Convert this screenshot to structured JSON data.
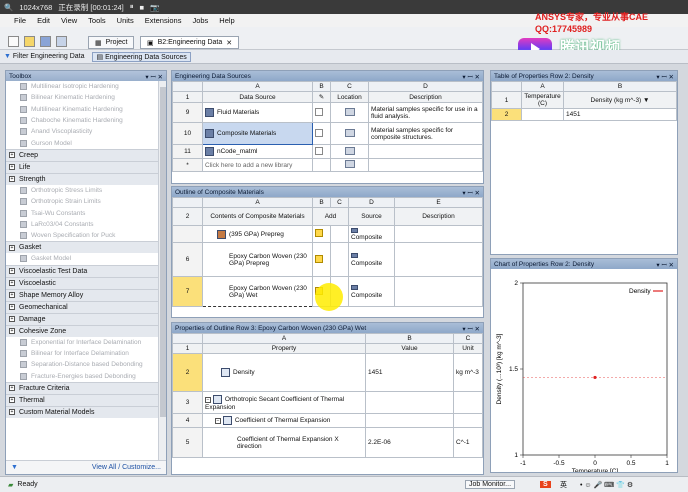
{
  "recorder": {
    "resolution": "1024x768",
    "status": "正在录制 [00:01:24]"
  },
  "menu": [
    "File",
    "Edit",
    "View",
    "Tools",
    "Units",
    "Extensions",
    "Jobs",
    "Help"
  ],
  "tabs": {
    "project": "Project",
    "engineering_data": "B2:Engineering Data"
  },
  "toolbar2": {
    "filter": "Filter Engineering Data",
    "sources": "Engineering Data Sources"
  },
  "watermark": {
    "line1": "ANSYS专家，专业从事CAE",
    "line2": "QQ:17745989",
    "logo": "腾讯视频"
  },
  "toolbox": {
    "title": "Toolbox",
    "items": [
      {
        "label": "Multilinear Isotropic Hardening",
        "kind": "dim"
      },
      {
        "label": "Bilinear Kinematic Hardening",
        "kind": "dim"
      },
      {
        "label": "Multilinear Kinematic Hardening",
        "kind": "dim"
      },
      {
        "label": "Chaboche Kinematic Hardening",
        "kind": "dim"
      },
      {
        "label": "Anand Viscoplasticity",
        "kind": "dim"
      },
      {
        "label": "Gurson Model",
        "kind": "dim"
      },
      {
        "label": "Creep",
        "kind": "cat"
      },
      {
        "label": "Life",
        "kind": "cat"
      },
      {
        "label": "Strength",
        "kind": "cat"
      },
      {
        "label": "Orthotropic Stress Limits",
        "kind": "dim"
      },
      {
        "label": "Orthotropic Strain Limits",
        "kind": "dim"
      },
      {
        "label": "Tsai-Wu Constants",
        "kind": "dim"
      },
      {
        "label": "LaRc03/04 Constants",
        "kind": "dim"
      },
      {
        "label": "Woven Specification for Puck",
        "kind": "dim"
      },
      {
        "label": "Gasket",
        "kind": "cat"
      },
      {
        "label": "Gasket Model",
        "kind": "dim"
      },
      {
        "label": "Viscoelastic Test Data",
        "kind": "cat"
      },
      {
        "label": "Viscoelastic",
        "kind": "cat"
      },
      {
        "label": "Shape Memory Alloy",
        "kind": "cat"
      },
      {
        "label": "Geomechanical",
        "kind": "cat"
      },
      {
        "label": "Damage",
        "kind": "cat"
      },
      {
        "label": "Cohesive Zone",
        "kind": "cat"
      },
      {
        "label": "Exponential for Interface Delamination",
        "kind": "dim"
      },
      {
        "label": "Bilinear for Interface Delamination",
        "kind": "dim"
      },
      {
        "label": "Separation-Distance based Debonding",
        "kind": "dim"
      },
      {
        "label": "Fracture-Energies based Debonding",
        "kind": "dim"
      },
      {
        "label": "Fracture Criteria",
        "kind": "cat"
      },
      {
        "label": "Thermal",
        "kind": "cat"
      },
      {
        "label": "Custom Material Models",
        "kind": "cat"
      }
    ],
    "footer": "View All / Customize..."
  },
  "eds": {
    "title": "Engineering Data Sources",
    "cols": [
      "A",
      "B",
      "C",
      "D"
    ],
    "headers": [
      "Data Source",
      "",
      "Location",
      "Description"
    ],
    "rows": [
      {
        "n": "9",
        "src": "Fluid Materials",
        "desc": "Material samples specific for use in a fluid analysis."
      },
      {
        "n": "10",
        "src": "Composite Materials",
        "desc": "Material samples specific for composite structures."
      },
      {
        "n": "11",
        "src": "nCode_matml",
        "desc": ""
      },
      {
        "n": "*",
        "src": "Click here to add a new library",
        "desc": ""
      }
    ]
  },
  "outline": {
    "title": "Outline of Composite Materials",
    "cols": [
      "A",
      "B",
      "C",
      "D",
      "E"
    ],
    "headers": [
      "Contents of Composite Materials",
      "Add",
      "",
      "Source",
      "Description"
    ],
    "rows": [
      {
        "n": "",
        "name": "(395 GPa) Prepreg",
        "src": "Composite"
      },
      {
        "n": "6",
        "name": "Epoxy Carbon Woven (230 GPa) Prepreg",
        "src": "Composite"
      },
      {
        "n": "7",
        "name": "Epoxy Carbon Woven (230 GPa) Wet",
        "src": "Composite"
      }
    ]
  },
  "props": {
    "title": "Properties of Outline Row 3: Epoxy Carbon Woven (230 GPa) Wet",
    "cols": [
      "A",
      "B",
      "C"
    ],
    "headers": [
      "Property",
      "Value",
      "Unit"
    ],
    "rows": [
      {
        "n": "2",
        "prop": "Density",
        "value": "1451",
        "unit": "kg m^-3"
      },
      {
        "n": "3",
        "prop": "Orthotropic Secant Coefficient of Thermal Expansion",
        "value": "",
        "unit": ""
      },
      {
        "n": "4",
        "prop": "Coefficient of Thermal Expansion",
        "value": "",
        "unit": ""
      },
      {
        "n": "5",
        "prop": "Coefficient of Thermal Expansion X direction",
        "value": "2.2E-06",
        "unit": "C^-1"
      }
    ]
  },
  "tprops": {
    "title": "Table of Properties Row 2: Density",
    "cols": [
      "A",
      "B"
    ],
    "headers": [
      "Temperature (C)",
      "Density (kg m^-3)"
    ],
    "rows": [
      {
        "n": "2",
        "t": "",
        "d": "1451"
      }
    ]
  },
  "chart_panel_title": "Chart of Properties Row 2: Density",
  "chart_data": {
    "type": "scatter",
    "series": [
      {
        "name": "Density",
        "points": [
          [
            0,
            1.451
          ]
        ],
        "color": "#e02020"
      }
    ],
    "xlabel": "Temperature [C]",
    "ylabel": "Density (...10³) [kg m^-3]",
    "xlim": [
      -1,
      1
    ],
    "ylim": [
      1,
      2
    ],
    "xticks": [
      "-1",
      "-0.5",
      "0",
      "0.5",
      "1"
    ],
    "yticks": [
      "1",
      "1.5",
      "2"
    ],
    "legend": "top-right"
  },
  "status": {
    "ready": "Ready",
    "job_monitor": "Job Monitor...",
    "ime": "英"
  }
}
